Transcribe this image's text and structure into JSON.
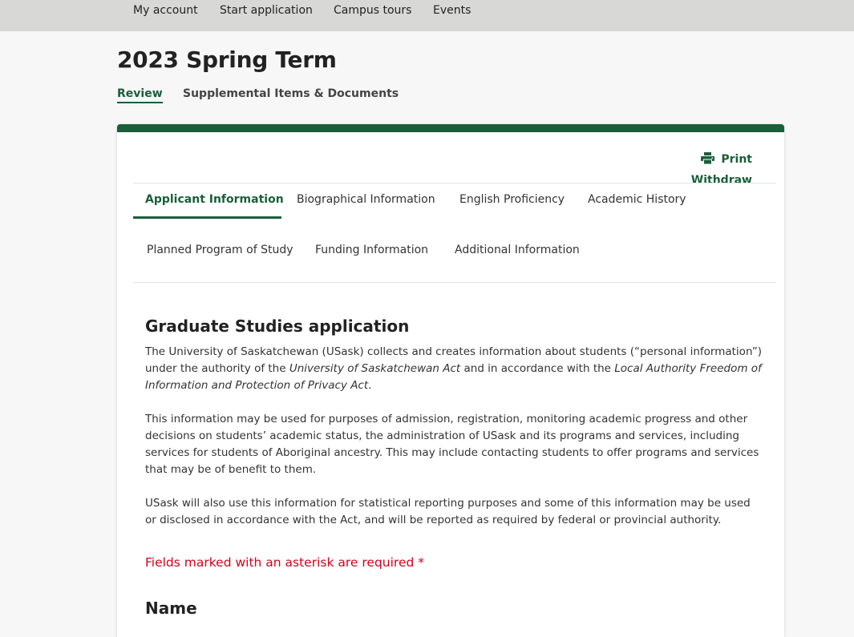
{
  "topnav": {
    "items": [
      "My account",
      "Start application",
      "Campus tours",
      "Events"
    ]
  },
  "page": {
    "title": "2023 Spring Term",
    "tabs": [
      "Review",
      "Supplemental Items & Documents"
    ]
  },
  "actions": {
    "print": "Print",
    "withdraw": "Withdraw"
  },
  "section_tabs": [
    "Applicant Information",
    "Biographical Information",
    "English Proficiency",
    "Academic History",
    "Planned Program of Study",
    "Funding Information",
    "Additional Information"
  ],
  "content": {
    "heading": "Graduate Studies application",
    "p1_a": "The University of Saskatchewan (USask) collects and creates information about students (“personal information”) under the authority of the ",
    "p1_act": "University of Saskatchewan Act",
    "p1_b": " and in accordance with the ",
    "p1_foip": "Local Authority Freedom of Information and Protection of Privacy Act",
    "p1_c": ".",
    "p2": "This information may be used for purposes of admission, registration, monitoring academic progress and other decisions on students’ academic status, the administration of USask and its programs and services, including services for students of Aboriginal ancestry. This may include contacting students to offer programs and services that may be of benefit to them.",
    "p3": "USask will also use this information for statistical reporting purposes and some of this information may be used or disclosed in accordance with the Act, and will be reported as required by federal or provincial authority.",
    "required_note": "Fields marked with an asterisk are required *",
    "name_heading": "Name"
  },
  "colors": {
    "accent": "#1a5e3a",
    "required": "#d0021b",
    "topbar": "#d8d8d6"
  },
  "icons": {
    "print": "printer-icon"
  }
}
